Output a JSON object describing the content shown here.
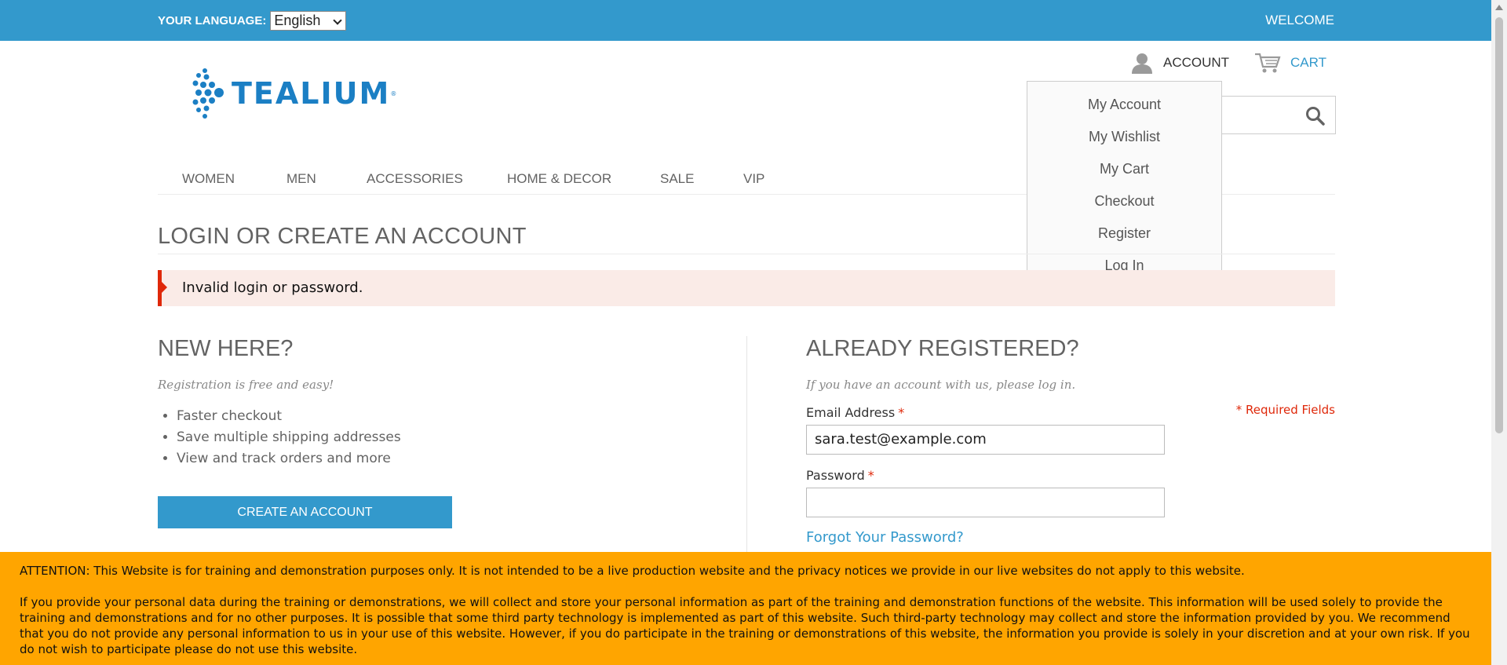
{
  "topbar": {
    "language_label": "YOUR LANGUAGE:",
    "language_selected": "English",
    "welcome": "WELCOME"
  },
  "header": {
    "logo_text": "TEALIUM",
    "account_label": "ACCOUNT",
    "cart_label": "CART",
    "account_menu": [
      "My Account",
      "My Wishlist",
      "My Cart",
      "Checkout",
      "Register",
      "Log In"
    ]
  },
  "nav": {
    "items": [
      "WOMEN",
      "MEN",
      "ACCESSORIES",
      "HOME & DECOR",
      "SALE",
      "VIP"
    ]
  },
  "page": {
    "title": "LOGIN OR CREATE AN ACCOUNT",
    "error": "Invalid login or password."
  },
  "new_customer": {
    "heading": "NEW HERE?",
    "intro": "Registration is free and easy!",
    "benefits": [
      "Faster checkout",
      "Save multiple shipping addresses",
      "View and track orders and more"
    ],
    "button": "CREATE AN ACCOUNT"
  },
  "login": {
    "heading": "ALREADY REGISTERED?",
    "intro": "If you have an account with us, please log in.",
    "required_note": "* Required Fields",
    "email_label": "Email Address",
    "email_value": "sara.test@example.com",
    "password_label": "Password",
    "password_value": "",
    "required_star": "*",
    "forgot": "Forgot Your Password?"
  },
  "notice": {
    "p1": "ATTENTION: This Website is for training and demonstration purposes only. It is not intended to be a live production website and the privacy notices we provide in our live websites do not apply to this website.",
    "p2": "If you provide your personal data during the training or demonstrations, we will collect and store your personal information as part of the training and demonstration functions of the website. This information will be used solely to provide the training and demonstrations and for no other purposes. It is possible that some third party technology is implemented as part of this website. Such third-party technology may collect and store the information provided by you. We recommend that you do not provide any personal information to us in your use of this website. However, if you do participate in the training or demonstrations of this website, the information you provide is solely in your discretion and at your own risk. If you do not wish to participate please do not use this website."
  },
  "colors": {
    "brand_blue": "#3399cc",
    "error_red": "#df280a",
    "notice_orange": "#ffa500"
  }
}
